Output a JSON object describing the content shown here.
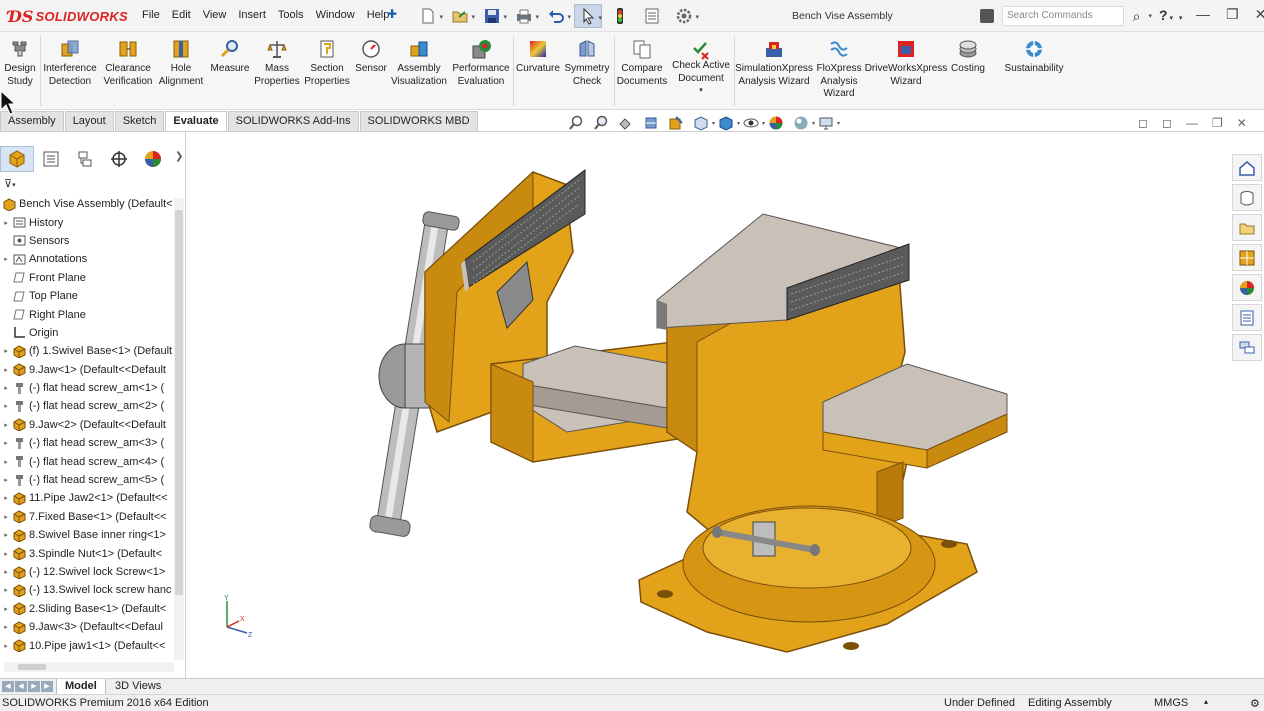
{
  "app": {
    "brand": "SOLIDWORKS",
    "document_title": "Bench Vise Assembly"
  },
  "menus": [
    "File",
    "Edit",
    "View",
    "Insert",
    "Tools",
    "Window",
    "Help"
  ],
  "search": {
    "placeholder": "Search Commands"
  },
  "help_label": "?",
  "commands": [
    {
      "label": "Design Study",
      "icon": "design-study-icon"
    },
    {
      "label": "Interference Detection",
      "icon": "interference-detection-icon"
    },
    {
      "label": "Clearance Verification",
      "icon": "clearance-verification-icon"
    },
    {
      "label": "Hole Alignment",
      "icon": "hole-alignment-icon"
    },
    {
      "label": "Measure",
      "icon": "measure-icon"
    },
    {
      "label": "Mass Properties",
      "icon": "mass-properties-icon"
    },
    {
      "label": "Section Properties",
      "icon": "section-properties-icon"
    },
    {
      "label": "Sensor",
      "icon": "sensor-icon"
    },
    {
      "label": "Assembly Visualization",
      "icon": "assembly-visualization-icon"
    },
    {
      "label": "Performance Evaluation",
      "icon": "performance-evaluation-icon"
    },
    {
      "label": "Curvature",
      "icon": "curvature-icon"
    },
    {
      "label": "Symmetry Check",
      "icon": "symmetry-check-icon"
    },
    {
      "label": "Compare Documents",
      "icon": "compare-documents-icon"
    },
    {
      "label": "Check Active Document",
      "icon": "check-active-document-icon"
    },
    {
      "label": "SimulationXpress Analysis Wizard",
      "icon": "simulationxpress-icon"
    },
    {
      "label": "FloXpress Analysis Wizard",
      "icon": "floxpress-icon"
    },
    {
      "label": "DriveWorksXpress Wizard",
      "icon": "driveworksxpress-icon"
    },
    {
      "label": "Costing",
      "icon": "costing-icon"
    },
    {
      "label": "Sustainability",
      "icon": "sustainability-icon"
    }
  ],
  "tabs": [
    {
      "label": "Assembly",
      "active": false
    },
    {
      "label": "Layout",
      "active": false
    },
    {
      "label": "Sketch",
      "active": false
    },
    {
      "label": "Evaluate",
      "active": true
    },
    {
      "label": "SOLIDWORKS Add-Ins",
      "active": false
    },
    {
      "label": "SOLIDWORKS MBD",
      "active": false
    }
  ],
  "tree": [
    {
      "label": "Bench Vise Assembly  (Default<",
      "icon": "assembly-icon",
      "expandable": false,
      "indent": 0
    },
    {
      "label": "History",
      "icon": "history-icon",
      "expandable": true,
      "indent": 1
    },
    {
      "label": "Sensors",
      "icon": "sensors-icon",
      "expandable": false,
      "indent": 1
    },
    {
      "label": "Annotations",
      "icon": "annotations-icon",
      "expandable": true,
      "indent": 1
    },
    {
      "label": "Front Plane",
      "icon": "plane-icon",
      "expandable": false,
      "indent": 1
    },
    {
      "label": "Top Plane",
      "icon": "plane-icon",
      "expandable": false,
      "indent": 1
    },
    {
      "label": "Right Plane",
      "icon": "plane-icon",
      "expandable": false,
      "indent": 1
    },
    {
      "label": "Origin",
      "icon": "origin-icon",
      "expandable": false,
      "indent": 1
    },
    {
      "label": "(f) 1.Swivel Base<1> (Default",
      "icon": "part-icon",
      "expandable": true,
      "indent": 1
    },
    {
      "label": "9.Jaw<1> (Default<<Default",
      "icon": "part-icon",
      "expandable": true,
      "indent": 1
    },
    {
      "label": "(-) flat head screw_am<1> (",
      "icon": "screw-icon",
      "expandable": true,
      "indent": 1
    },
    {
      "label": "(-) flat head screw_am<2> (",
      "icon": "screw-icon",
      "expandable": true,
      "indent": 1
    },
    {
      "label": "9.Jaw<2> (Default<<Default",
      "icon": "part-icon",
      "expandable": true,
      "indent": 1
    },
    {
      "label": "(-) flat head screw_am<3> (",
      "icon": "screw-icon",
      "expandable": true,
      "indent": 1
    },
    {
      "label": "(-) flat head screw_am<4> (",
      "icon": "screw-icon",
      "expandable": true,
      "indent": 1
    },
    {
      "label": "(-) flat head screw_am<5> (",
      "icon": "screw-icon",
      "expandable": true,
      "indent": 1
    },
    {
      "label": "11.Pipe Jaw2<1> (Default<<",
      "icon": "part-icon",
      "expandable": true,
      "indent": 1
    },
    {
      "label": "7.Fixed Base<1> (Default<<",
      "icon": "part-icon",
      "expandable": true,
      "indent": 1
    },
    {
      "label": "8.Swivel Base inner ring<1>",
      "icon": "part-icon",
      "expandable": true,
      "indent": 1
    },
    {
      "label": "3.Spindle Nut<1> (Default<",
      "icon": "part-icon",
      "expandable": true,
      "indent": 1
    },
    {
      "label": "(-) 12.Swivel lock Screw<1>",
      "icon": "part-icon",
      "expandable": true,
      "indent": 1
    },
    {
      "label": "(-) 13.Swivel lock screw hanc",
      "icon": "part-icon",
      "expandable": true,
      "indent": 1
    },
    {
      "label": "2.Sliding Base<1> (Default<",
      "icon": "part-icon",
      "expandable": true,
      "indent": 1
    },
    {
      "label": "9.Jaw<3> (Default<<Defaul",
      "icon": "part-icon",
      "expandable": true,
      "indent": 1
    },
    {
      "label": "10.Pipe jaw1<1> (Default<<",
      "icon": "part-icon",
      "expandable": true,
      "indent": 1
    }
  ],
  "bottom_tabs": [
    {
      "label": "Model",
      "active": true
    },
    {
      "label": "3D Views",
      "active": false
    }
  ],
  "status": {
    "edition": "SOLIDWORKS Premium 2016 x64 Edition",
    "state": "Under Defined",
    "mode": "Editing Assembly",
    "units": "MMGS"
  },
  "colors": {
    "vise_body": "#e2a21a",
    "vise_shadow": "#b97a0a",
    "jaw_gray": "#c9c0b8",
    "accent_red": "#d22222"
  }
}
